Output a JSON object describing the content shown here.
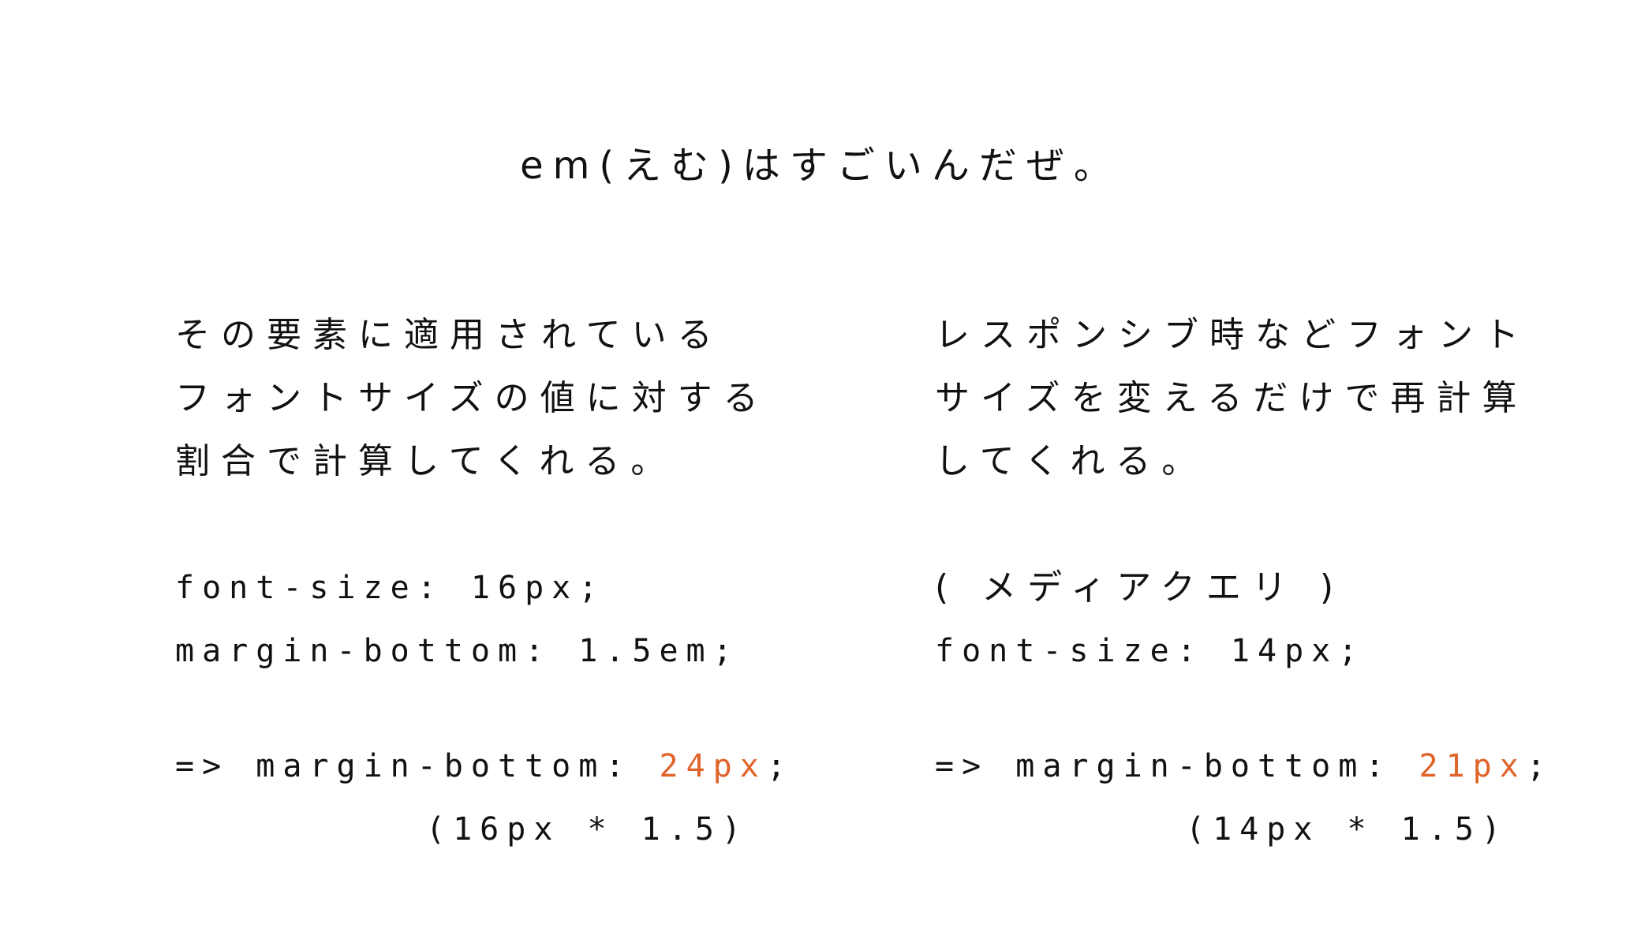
{
  "title": "em(えむ)はすごいんだぜ。",
  "left": {
    "para": [
      "その要素に適用されている",
      "フォントサイズの値に対する",
      "割合で計算してくれる。"
    ],
    "code1": "font-size: 16px;",
    "code2": "margin-bottom: 1.5em;",
    "result_prefix": "=> margin-bottom: ",
    "result_value": "24px",
    "result_suffix": ";",
    "calc": "(16px * 1.5)"
  },
  "right": {
    "para": [
      "レスポンシブ時などフォント",
      "サイズを変えるだけで再計算",
      "してくれる。"
    ],
    "note": "( メディアクエリ )",
    "code1": "font-size: 14px;",
    "result_prefix": "=> margin-bottom: ",
    "result_value": "21px",
    "result_suffix": ";",
    "calc": "(14px * 1.5)"
  },
  "colors": {
    "text": "#111111",
    "accent": "#e0632a",
    "background": "#ffffff"
  }
}
